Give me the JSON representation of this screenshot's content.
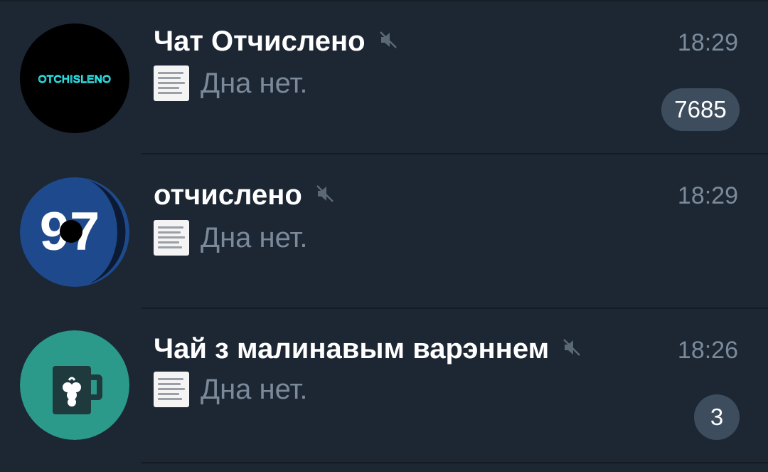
{
  "chats": [
    {
      "title": "Чат Отчислено",
      "time": "18:29",
      "preview": "Дна нет.",
      "unread": "7685",
      "muted": true,
      "avatar": {
        "type": "neon-logo",
        "text": "OTCHISLENO",
        "bg": "#000000",
        "fg": "#2fe3e8"
      }
    },
    {
      "title": "отчислено",
      "time": "18:29",
      "preview": "Дна нет.",
      "unread": "",
      "muted": true,
      "avatar": {
        "type": "number-logo",
        "text": "97",
        "bg": "#1e4a8d",
        "fg": "#ffffff"
      }
    },
    {
      "title": "Чай з малинавым варэннем",
      "time": "18:26",
      "preview": "Дна нет.",
      "unread": "3",
      "muted": true,
      "avatar": {
        "type": "mug-icon",
        "bg": "#2b9a8b",
        "fg": "#1f3a3d"
      }
    }
  ],
  "colors": {
    "background": "#1d2733",
    "title": "#ffffff",
    "secondary": "#7b8a9a",
    "badge": "#3d4d5e",
    "divider": "#141b24"
  },
  "icons": {
    "mute": "volume-off-icon"
  }
}
